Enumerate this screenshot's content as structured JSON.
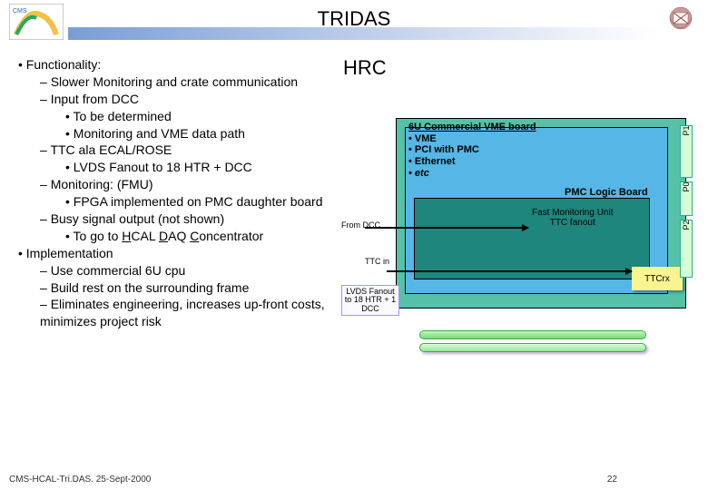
{
  "header": {
    "title": "TRIDAS",
    "subtitle": "HRC"
  },
  "content": {
    "functionality": "Functionality:",
    "items": [
      "Slower Monitoring and crate communication",
      "Input from DCC"
    ],
    "sub_items": [
      "To be determined",
      "Monitoring and VME data path"
    ],
    "ttc": "TTC ala ECAL/ROSE",
    "ttc_sub": "LVDS Fanout to 18 HTR + DCC",
    "monitoring": "Monitoring:  (FMU)",
    "monitoring_sub": "FPGA implemented on PMC daughter board",
    "busy": "Busy signal output (not shown)",
    "busy_sub_prefix": "To go to ",
    "busy_sub_h": "H",
    "busy_sub_cal": "CAL ",
    "busy_sub_d": "D",
    "busy_sub_aq": "AQ ",
    "busy_sub_c": "C",
    "busy_sub_onc": "oncentrator",
    "implementation": "Implementation",
    "impl_items": [
      "Use commercial 6U cpu",
      "Build rest on the surrounding frame",
      "Eliminates engineering, increases up-front costs, minimizes project risk"
    ]
  },
  "diagram": {
    "board_title": "6U Commercial VME board",
    "board_items": [
      "VME",
      "PCI with PMC",
      "Ethernet",
      "etc"
    ],
    "pmc_label": "PMC Logic Board",
    "fmu_line1": "Fast Monitoring Unit",
    "fmu_line2": "TTC fanout",
    "from_dcc": "From DCC",
    "ttc_in": "TTC in",
    "lvds": "LVDS Fanout to 18 HTR + 1 DCC",
    "ttcrx": "TTCrx",
    "p0": "P0",
    "p1": "P1",
    "p2": "P2"
  },
  "footer": {
    "left": "CMS-HCAL-Tri.DAS. 25-Sept-2000",
    "page": "22"
  }
}
